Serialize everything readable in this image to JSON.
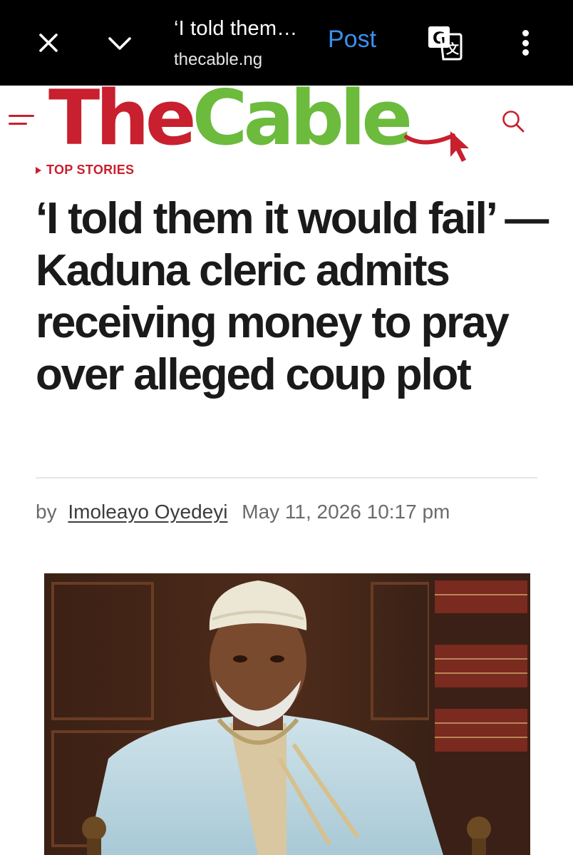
{
  "browser": {
    "title": "‘I told them…",
    "url": "thecable.ng",
    "post_label": "Post",
    "icons": [
      "close-icon",
      "chevron-down-icon",
      "translate-icon",
      "more-vertical-icon"
    ]
  },
  "site": {
    "logo_the": "The",
    "logo_cable": "Cable",
    "brand_red": "#c8202e",
    "brand_green": "#6cbb3c"
  },
  "article": {
    "category": "TOP STORIES",
    "headline": "‘I told them it would fail’ — Kaduna cleric admits receiving money to pray over alleged coup plot",
    "by_label": "by",
    "author": "Imoleayo Oyedeyi",
    "date": "May 11, 2026 10:17 pm"
  }
}
